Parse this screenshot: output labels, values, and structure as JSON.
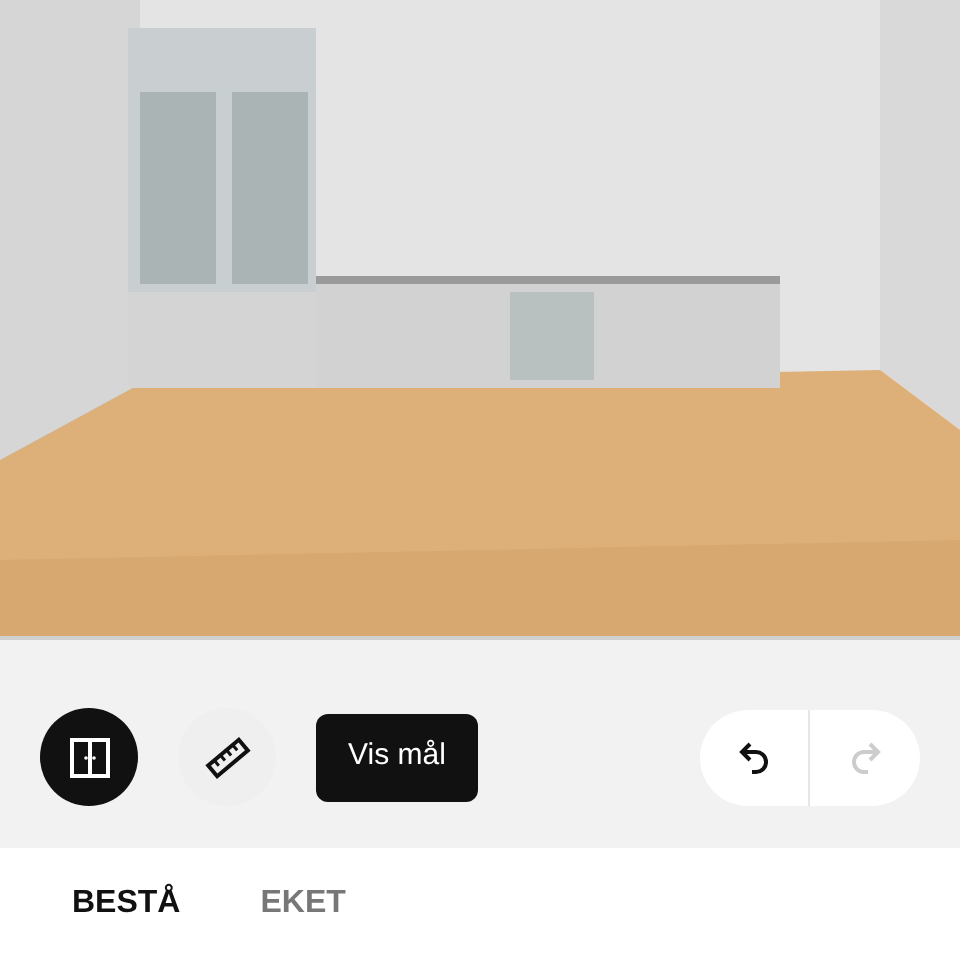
{
  "toolbar": {
    "tools": [
      {
        "kind": "doors",
        "selected": true
      },
      {
        "kind": "ruler",
        "selected": false
      }
    ],
    "show_measurements": "Vis mål",
    "undo": {
      "disabled": false
    },
    "redo": {
      "disabled": true
    }
  },
  "tabs": [
    {
      "label": "BESTÅ",
      "selected": true
    },
    {
      "label": "EKET",
      "selected": false
    }
  ]
}
